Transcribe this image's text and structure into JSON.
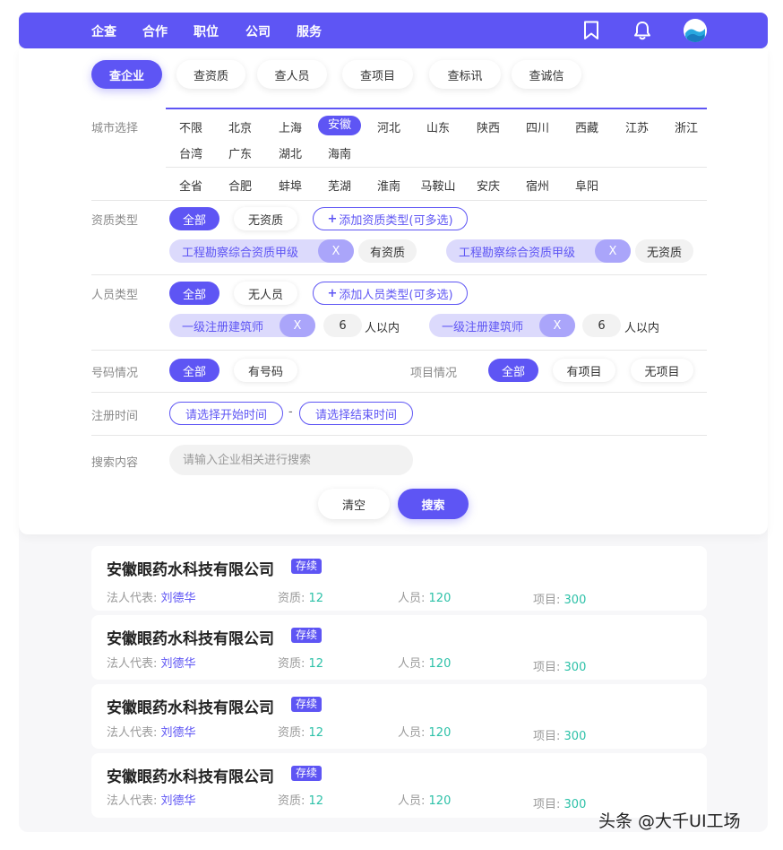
{
  "nav": {
    "items": [
      "企查",
      "合作",
      "职位",
      "公司",
      "服务"
    ],
    "colors": {
      "accent": "#5e55f4",
      "teal": "#2dc1a8"
    }
  },
  "tabs": [
    "查企业",
    "查资质",
    "查人员",
    "查项目",
    "查标讯",
    "查诚信"
  ],
  "city": {
    "label": "城市选择",
    "provinces_row1": [
      "不限",
      "北京",
      "上海",
      "安徽",
      "河北",
      "山东",
      "陕西",
      "四川",
      "西藏",
      "江苏",
      "浙江"
    ],
    "provinces_row2": [
      "台湾",
      "广东",
      "湖北",
      "海南"
    ],
    "selected": "安徽",
    "cities": [
      "全省",
      "合肥",
      "蚌埠",
      "芜湖",
      "淮南",
      "马鞍山",
      "安庆",
      "宿州",
      "阜阳"
    ]
  },
  "qualification": {
    "label": "资质类型",
    "all": "全部",
    "none": "无资质",
    "add": "添加资质类型(可多选)",
    "tags": [
      {
        "name": "工程勘察综合资质甲级",
        "close": "X",
        "state": "有资质"
      },
      {
        "name": "工程勘察综合资质甲级",
        "close": "X",
        "state": "无资质"
      }
    ]
  },
  "personnel": {
    "label": "人员类型",
    "all": "全部",
    "none": "无人员",
    "add": "添加人员类型(可多选)",
    "tags": [
      {
        "name": "一级注册建筑师",
        "close": "X",
        "count": "6",
        "suffix": "人以内"
      },
      {
        "name": "一级注册建筑师",
        "close": "X",
        "count": "6",
        "suffix": "人以内"
      }
    ]
  },
  "phone": {
    "label": "号码情况",
    "all": "全部",
    "has": "有号码"
  },
  "project": {
    "label": "项目情况",
    "all": "全部",
    "has": "有项目",
    "none": "无项目"
  },
  "register": {
    "label": "注册时间",
    "start": "请选择开始时间",
    "dash": "-",
    "end": "请选择结束时间"
  },
  "search": {
    "label": "搜索内容",
    "placeholder": "请输入企业相关进行搜索",
    "clear": "清空",
    "submit": "搜索"
  },
  "results": [
    {
      "name": "安徽眼药水科技有限公司",
      "status": "存续",
      "rep_label": "法人代表:",
      "rep": "刘德华",
      "qual_label": "资质:",
      "qual": "12",
      "staff_label": "人员:",
      "staff": "120",
      "proj_label": "项目:",
      "proj": "300"
    },
    {
      "name": "安徽眼药水科技有限公司",
      "status": "存续",
      "rep_label": "法人代表:",
      "rep": "刘德华",
      "qual_label": "资质:",
      "qual": "12",
      "staff_label": "人员:",
      "staff": "120",
      "proj_label": "项目:",
      "proj": "300"
    },
    {
      "name": "安徽眼药水科技有限公司",
      "status": "存续",
      "rep_label": "法人代表:",
      "rep": "刘德华",
      "qual_label": "资质:",
      "qual": "12",
      "staff_label": "人员:",
      "staff": "120",
      "proj_label": "项目:",
      "proj": "300"
    },
    {
      "name": "安徽眼药水科技有限公司",
      "status": "存续",
      "rep_label": "法人代表:",
      "rep": "刘德华",
      "qual_label": "资质:",
      "qual": "12",
      "staff_label": "人员:",
      "staff": "120",
      "proj_label": "项目:",
      "proj": "300"
    }
  ],
  "watermark": "头条 @大千UI工场",
  "icons": [
    "bookmark-icon",
    "bell-icon",
    "avatar"
  ]
}
